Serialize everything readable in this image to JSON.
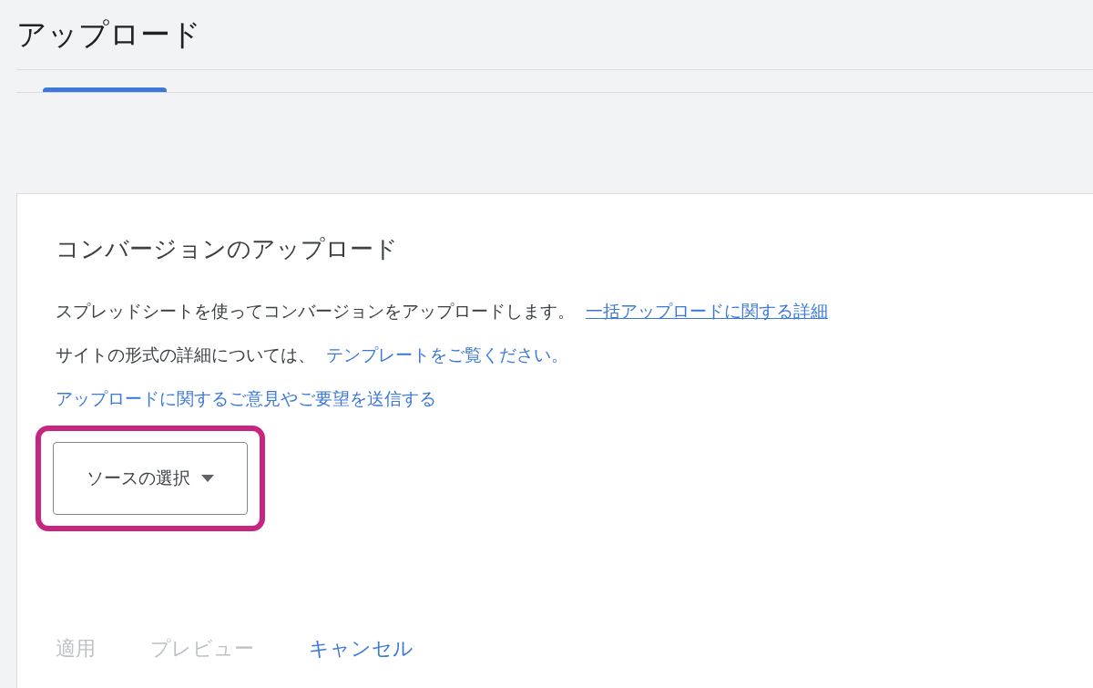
{
  "page_title": "アップロード",
  "tabs": [
    {
      "selected": true
    }
  ],
  "card": {
    "title": "コンバージョンのアップロード",
    "paragraphs": [
      {
        "text": "スプレッドシートを使ってコンバージョンをアップロードします。",
        "link": "一括アップロードに関する詳細",
        "underlined": true
      },
      {
        "text": "サイトの形式の詳細については、",
        "link": "テンプレートをご覧ください。",
        "underlined": false
      },
      {
        "link": "アップロードに関するご意見やご要望を送信する",
        "underlined": false
      }
    ],
    "dropdown": {
      "label": "ソースの選択",
      "highlighted": true
    },
    "buttons": [
      {
        "label": "適用",
        "disabled": true
      },
      {
        "label": "プレビュー",
        "disabled": true
      },
      {
        "label": "キャンセル",
        "disabled": false
      }
    ]
  }
}
